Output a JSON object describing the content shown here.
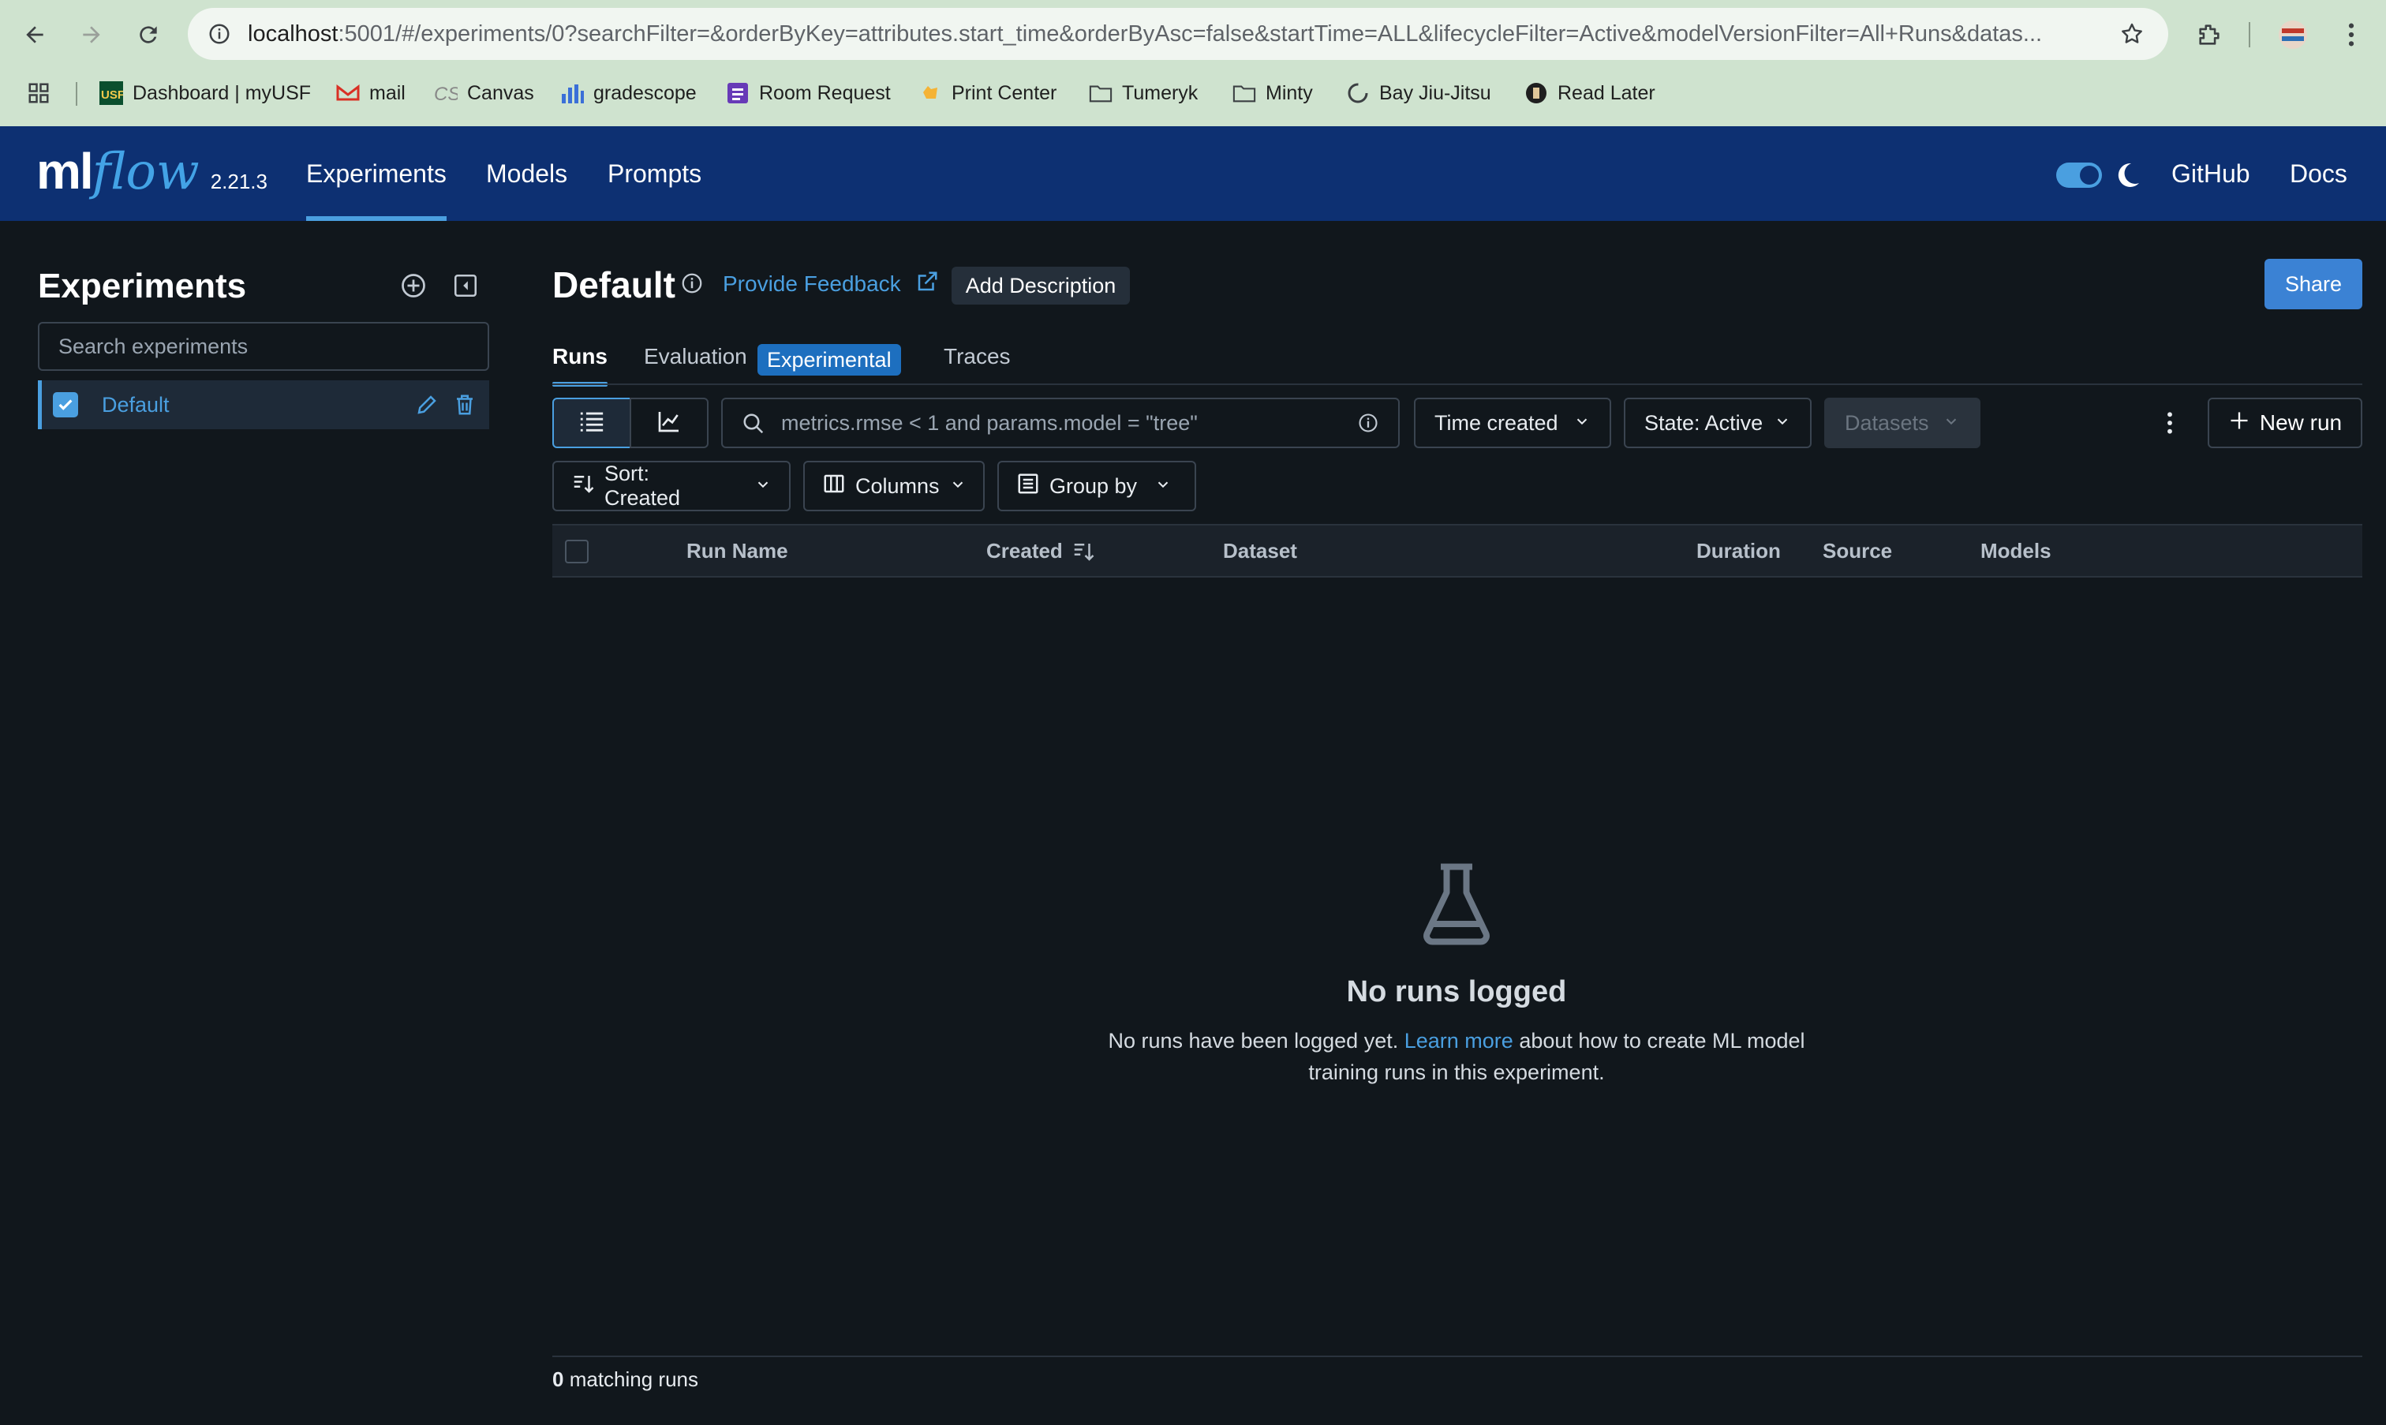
{
  "browser": {
    "url_host": "localhost",
    "url_path": ":5001/#/experiments/0?searchFilter=&orderByKey=attributes.start_time&orderByAsc=false&startTime=ALL&lifecycleFilter=Active&modelVersionFilter=All+Runs&datas...",
    "bookmarks": [
      {
        "label": "Dashboard | myUSF",
        "icon": "usf-icon"
      },
      {
        "label": "mail",
        "icon": "gmail-icon"
      },
      {
        "label": "Canvas",
        "icon": "canvas-icon"
      },
      {
        "label": "gradescope",
        "icon": "gradescope-icon"
      },
      {
        "label": "Room Request",
        "icon": "form-icon"
      },
      {
        "label": "Print Center",
        "icon": "hand-icon"
      },
      {
        "label": "Tumeryk",
        "icon": "folder-icon"
      },
      {
        "label": "Minty",
        "icon": "folder-icon"
      },
      {
        "label": "Bay Jiu-Jitsu",
        "icon": "circle-icon"
      },
      {
        "label": "Read Later",
        "icon": "read-later-icon"
      }
    ]
  },
  "header": {
    "logo_ml": "ml",
    "logo_flow": "flow",
    "version": "2.21.3",
    "nav": [
      {
        "label": "Experiments",
        "active": true
      },
      {
        "label": "Models",
        "active": false
      },
      {
        "label": "Prompts",
        "active": false
      }
    ],
    "github": "GitHub",
    "docs": "Docs",
    "accent": "#0d3072"
  },
  "sidebar": {
    "title": "Experiments",
    "search_placeholder": "Search experiments",
    "items": [
      {
        "label": "Default",
        "checked": true
      }
    ]
  },
  "main": {
    "title": "Default",
    "feedback": "Provide Feedback",
    "add_description": "Add Description",
    "share": "Share",
    "tabs": {
      "runs": "Runs",
      "evaluation": "Evaluation",
      "evaluation_badge": "Experimental",
      "traces": "Traces"
    },
    "filter_placeholder": "metrics.rmse < 1 and params.model = \"tree\"",
    "time_created": "Time created",
    "state": "State: Active",
    "datasets": "Datasets",
    "new_run": "New run",
    "sort": "Sort: Created",
    "columns": "Columns",
    "group_by": "Group by",
    "table_headers": [
      "Run Name",
      "Created",
      "Dataset",
      "Duration",
      "Source",
      "Models"
    ],
    "empty": {
      "title": "No runs logged",
      "body_before": "No runs have been logged yet.",
      "link": "Learn more",
      "body_after": "about how to create ML model training runs in this experiment."
    },
    "footer_count": "0",
    "footer_label": "matching runs"
  }
}
